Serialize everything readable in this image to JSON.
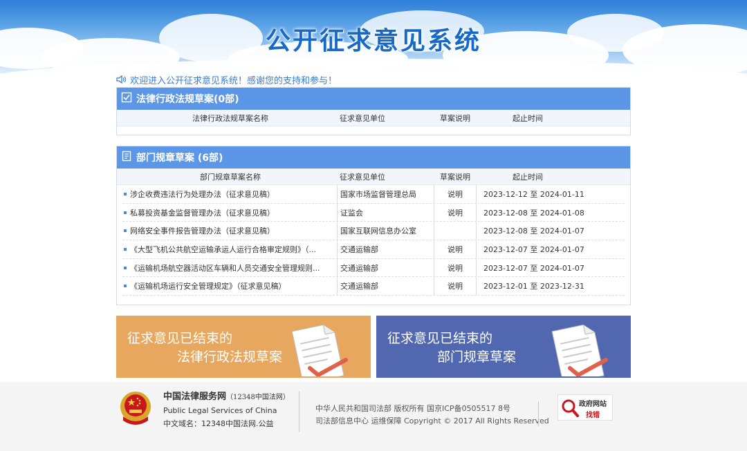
{
  "header": {
    "title": "公开征求意见系统"
  },
  "welcome": {
    "text": "欢迎进入公开征求意见系统！感谢您的支持和参与！"
  },
  "law_panel": {
    "title": "法律行政法规草案(0部)",
    "columns": [
      "法律行政法规草案名称",
      "征求意见单位",
      "草案说明",
      "起止时间"
    ],
    "rows": []
  },
  "dept_panel": {
    "title": "部门规章草案 (6部)",
    "columns": [
      "部门规章草案名称",
      "征求意见单位",
      "草案说明",
      "起止时间"
    ],
    "rows": [
      {
        "name": "涉企收费违法行为处理办法（征求意见稿）",
        "unit": "国家市场监督管理总局",
        "desc": "说明",
        "time": "2023-12-12 至 2024-01-11"
      },
      {
        "name": "私募投资基金监督管理办法（征求意见稿）",
        "unit": "证监会",
        "desc": "说明",
        "time": "2023-12-08 至 2024-01-08"
      },
      {
        "name": "网络安全事件报告管理办法（征求意见稿）",
        "unit": "国家互联网信息办公室",
        "desc": "",
        "time": "2023-12-08 至 2024-01-07"
      },
      {
        "name": "《大型飞机公共航空运输承运人运行合格审定规则》（...",
        "unit": "交通运输部",
        "desc": "说明",
        "time": "2023-12-07 至 2024-01-07"
      },
      {
        "name": "《运输机场航空器活动区车辆和人员交通安全管理规则...",
        "unit": "交通运输部",
        "desc": "说明",
        "time": "2023-12-07 至 2024-01-07"
      },
      {
        "name": "《运输机场运行安全管理规定》（征求意见稿）",
        "unit": "交通运输部",
        "desc": "说明",
        "time": "2023-12-01 至 2023-12-31"
      }
    ]
  },
  "banners": {
    "law": {
      "line1": "征求意见已结束的",
      "line2": "法律行政法规草案",
      "color": "#e8a75e"
    },
    "dept": {
      "line1": "征求意见已结束的",
      "line2": "部门规章草案",
      "color": "#5168b0"
    }
  },
  "footer": {
    "brand_cn": "中国法律服务网",
    "brand_cn_sub": "（12348中国法网）",
    "brand_en": "Public Legal Services of China",
    "domain": "中文域名：12348中国法网.公益",
    "copyright_line1": "中华人民共和国司法部 版权所有 国京ICP备0505517 8号",
    "copyright_line2": "司法部信息中心 运维保障   Copyright © 2017 All Rights Reserved",
    "gov_line1": "政府网站",
    "gov_line2": "找错"
  },
  "colors": {
    "accent": "#5b97e6",
    "title": "#1769c9",
    "link": "#3a7bd5"
  },
  "icons": [
    "speaker-icon",
    "checkbox-icon",
    "document-icon",
    "national-emblem-icon",
    "magnifier-icon"
  ]
}
